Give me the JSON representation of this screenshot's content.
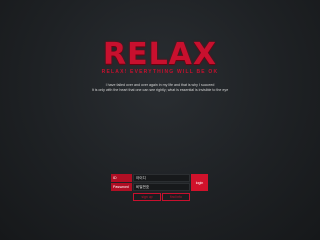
{
  "brand": {
    "logo": "RELAX",
    "tagline": "RELAX! EVERYTHING WILL BE OK"
  },
  "quote": {
    "line1": "I have failed over and over again in my life and that is why I succeed",
    "line2": "It is only with the heart that one can see rightly; what is essential is invisible to the eye"
  },
  "login": {
    "id_label": "ID",
    "password_label": "Password",
    "id_value": "아이디",
    "password_value": "비밀번호",
    "login_button": "login",
    "button_one": "sign up",
    "button_two": "find info"
  },
  "colors": {
    "background": "#1e2124",
    "accent": "#c8102e"
  }
}
